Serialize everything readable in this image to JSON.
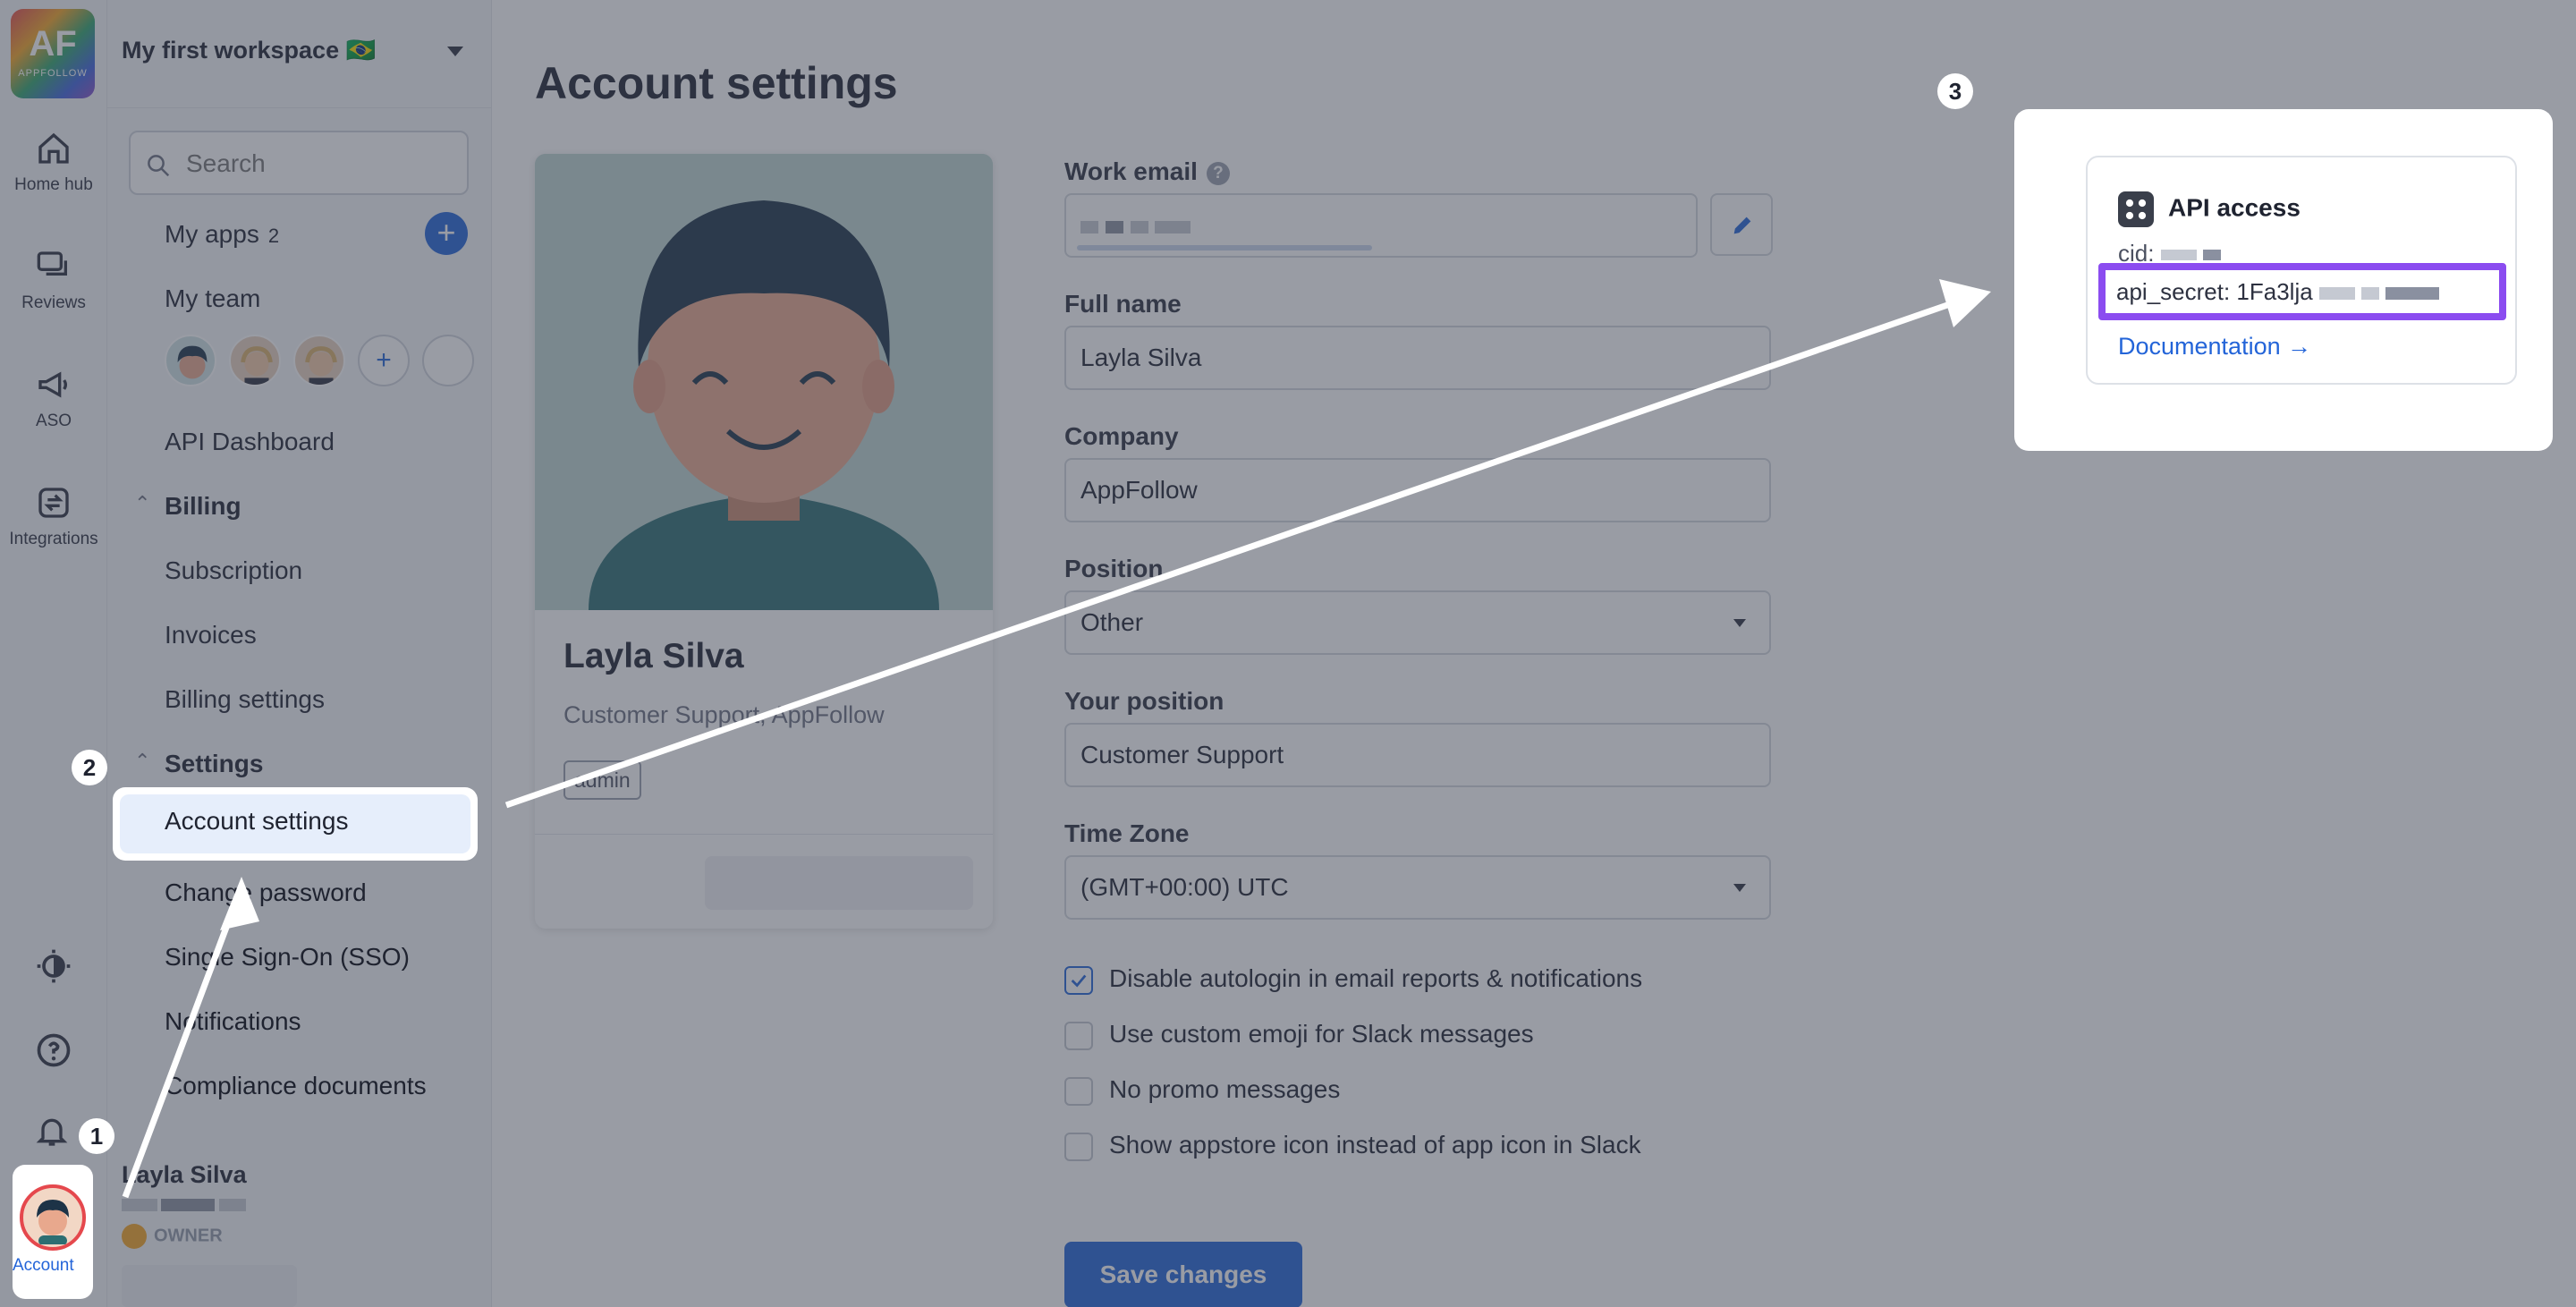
{
  "rail": {
    "logo_text": "AF",
    "logo_sub": "APPFOLLOW",
    "items": [
      {
        "label": "Home hub",
        "icon": "home-icon"
      },
      {
        "label": "Reviews",
        "icon": "reviews-icon"
      },
      {
        "label": "ASO",
        "icon": "megaphone-icon"
      },
      {
        "label": "Integrations",
        "icon": "integrations-icon"
      }
    ],
    "bottom_icons": [
      "theme-icon",
      "help-icon",
      "bell-icon"
    ],
    "account_label": "Account"
  },
  "sidebar": {
    "workspace": "My first workspace 🇧🇷",
    "search_placeholder": "Search",
    "my_apps": "My apps",
    "my_apps_count": "2",
    "my_team": "My team",
    "api_dashboard": "API Dashboard",
    "billing_head": "Billing",
    "billing_items": [
      "Subscription",
      "Invoices",
      "Billing settings"
    ],
    "settings_head": "Settings",
    "settings_items": [
      "Account settings",
      "Change password",
      "Single Sign-On (SSO)",
      "Notifications",
      "Compliance documents"
    ],
    "user_name": "Layla Silva",
    "user_role": "OWNER"
  },
  "main": {
    "title": "Account settings",
    "profile": {
      "name": "Layla Silva",
      "role": "Customer Support, AppFollow",
      "tag": "admin"
    },
    "form": {
      "work_email_label": "Work email",
      "full_name_label": "Full name",
      "full_name": "Layla Silva",
      "company_label": "Company",
      "company": "AppFollow",
      "position_label": "Position",
      "position": "Other",
      "your_position_label": "Your position",
      "your_position": "Customer Support",
      "timezone_label": "Time Zone",
      "timezone": "(GMT+00:00) UTC"
    },
    "checkboxes": [
      {
        "label": "Disable autologin in email reports & notifications",
        "checked": true
      },
      {
        "label": "Use custom emoji for Slack messages",
        "checked": false
      },
      {
        "label": "No promo messages",
        "checked": false
      },
      {
        "label": "Show appstore icon instead of app icon in Slack",
        "checked": false
      }
    ],
    "save_label": "Save changes"
  },
  "api_callout": {
    "title": "API access",
    "cid_label": "cid:",
    "secret_label": "api_secret: 1Fa3lja",
    "doc_link": "Documentation →"
  },
  "steps": [
    "1",
    "2",
    "3"
  ],
  "colors": {
    "accent": "#2364d8",
    "highlight": "#8b4cf0",
    "danger": "#e5484d"
  }
}
